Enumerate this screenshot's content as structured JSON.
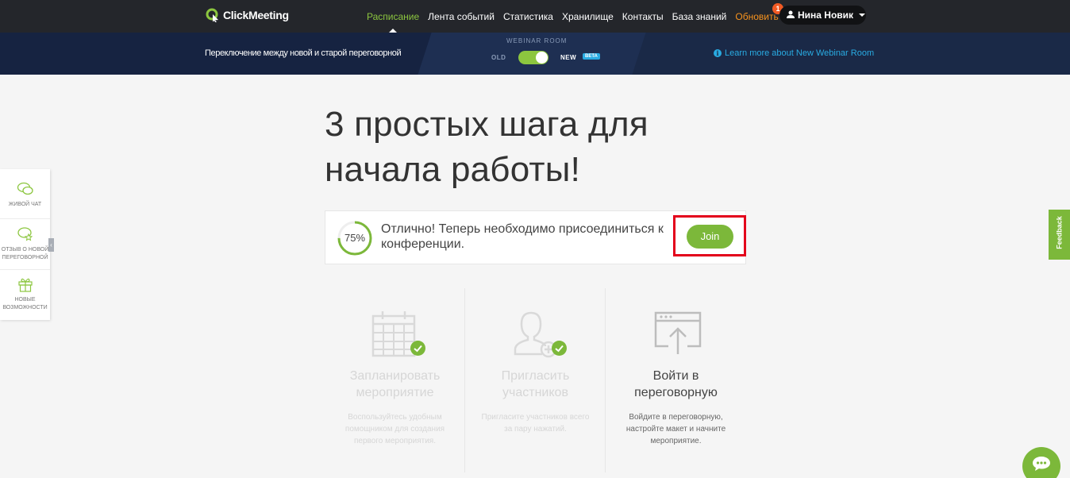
{
  "brand": {
    "name": "ClickMeeting",
    "accent": "#8cc63f"
  },
  "nav": {
    "items": [
      {
        "label": "Расписание",
        "active": true
      },
      {
        "label": "Лента событий"
      },
      {
        "label": "Статистика"
      },
      {
        "label": "Хранилище"
      },
      {
        "label": "Контакты"
      },
      {
        "label": "База знаний"
      }
    ],
    "upgrade_label": "Обновить",
    "notification_count": "1",
    "user_name": "Нина Новик"
  },
  "banner": {
    "switch_text": "Переключение между новой и старой переговорной",
    "webinar_room_label": "WEBINAR ROOM",
    "old_label": "OLD",
    "new_label": "NEW",
    "beta_label": "BETA",
    "toggle_state": "new",
    "learn_more": "Learn more about New Webinar Room"
  },
  "main": {
    "title": "3 простых шага для начала работы!",
    "progress": {
      "percent_label": "75%",
      "percent_value": 75,
      "message": "Отлично! Теперь необходимо присоединиться к конференции.",
      "join_label": "Join"
    },
    "steps": [
      {
        "title": "Запланировать мероприятие",
        "desc": "Воспользуйтесь удобным помощником для создания первого мероприятия.",
        "icon": "calendar-icon",
        "done": true
      },
      {
        "title": "Пригласить участников",
        "desc": "Пригласите участников всего за пару нажатий.",
        "icon": "invite-user-icon",
        "done": true
      },
      {
        "title": "Войти в переговорную",
        "desc": "Войдите в переговорную, настройте макет и начните мероприятие.",
        "icon": "enter-room-icon",
        "done": false
      }
    ]
  },
  "side_menu": {
    "items": [
      {
        "label": "ЖИВОЙ ЧАТ",
        "icon": "chat-icon"
      },
      {
        "label": "ОТЗЫВ О НОВОЙ ПЕРЕГОВОРНОЙ",
        "icon": "feedback-star-icon"
      },
      {
        "label": "НОВЫЕ ВОЗМОЖНОСТИ",
        "icon": "gift-icon"
      }
    ]
  },
  "feedback_tab": {
    "label": "Feedback"
  }
}
